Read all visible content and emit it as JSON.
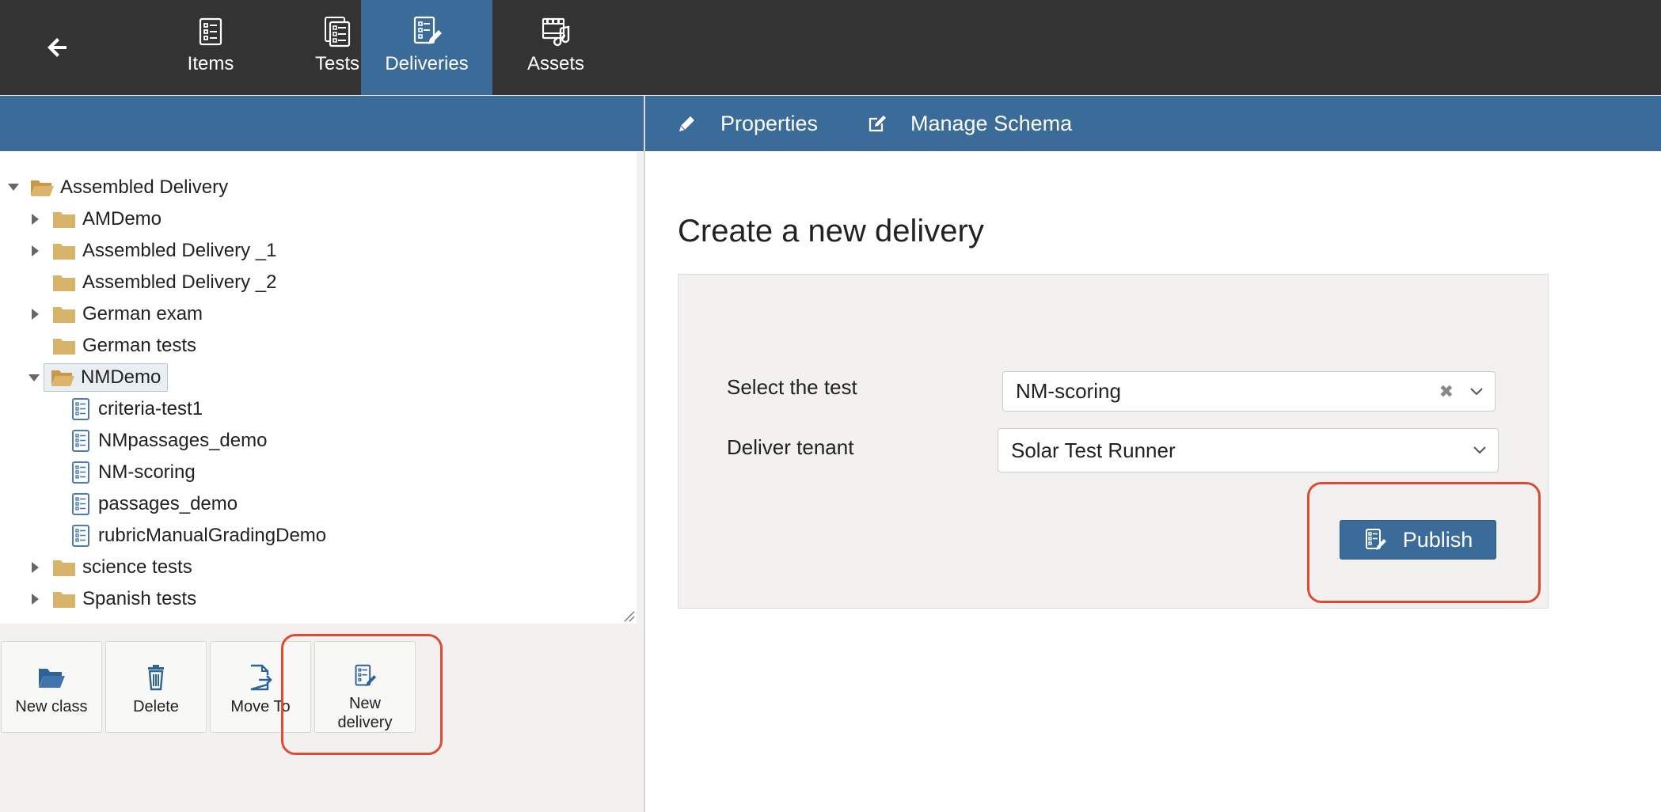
{
  "nav": {
    "tabs": [
      {
        "label": "Items",
        "icon": "items-icon"
      },
      {
        "label": "Tests",
        "icon": "tests-icon"
      },
      {
        "label": "Deliveries",
        "icon": "deliveries-icon",
        "active": true
      },
      {
        "label": "Assets",
        "icon": "assets-icon"
      }
    ]
  },
  "tree": {
    "root": "Assembled Delivery",
    "nodes": [
      {
        "label": "AMDemo",
        "type": "folder",
        "expanded": false
      },
      {
        "label": "Assembled Delivery _1",
        "type": "folder",
        "expanded": false
      },
      {
        "label": "Assembled Delivery _2",
        "type": "folder"
      },
      {
        "label": "German exam",
        "type": "folder",
        "expanded": false
      },
      {
        "label": "German tests",
        "type": "folder"
      },
      {
        "label": "NMDemo",
        "type": "folder",
        "expanded": true,
        "selected": true
      },
      {
        "label": "criteria-test1",
        "type": "delivery"
      },
      {
        "label": "NMpassages_demo",
        "type": "delivery"
      },
      {
        "label": "NM-scoring",
        "type": "delivery"
      },
      {
        "label": "passages_demo",
        "type": "delivery"
      },
      {
        "label": "rubricManualGradingDemo",
        "type": "delivery"
      },
      {
        "label": "science tests",
        "type": "folder",
        "expanded": false
      },
      {
        "label": "Spanish tests",
        "type": "folder",
        "expanded": false
      }
    ]
  },
  "toolbar": {
    "new_class": "New class",
    "delete": "Delete",
    "move_to": "Move To",
    "new_delivery_1": "New",
    "new_delivery_2": "delivery"
  },
  "right_tabs": {
    "properties": "Properties",
    "manage_schema": "Manage Schema"
  },
  "form": {
    "title": "Create a new delivery",
    "select_test_label": "Select the test",
    "select_test_value": "NM-scoring",
    "clear_symbol": "✖",
    "tenant_label": "Deliver tenant",
    "tenant_value": "Solar Test Runner",
    "publish_label": "Publish"
  },
  "colors": {
    "topbar": "#333333",
    "accent": "#3b6b98",
    "highlight": "#e04a33",
    "folder": "#d8b36a",
    "panel_bg": "#f2f1ef"
  }
}
